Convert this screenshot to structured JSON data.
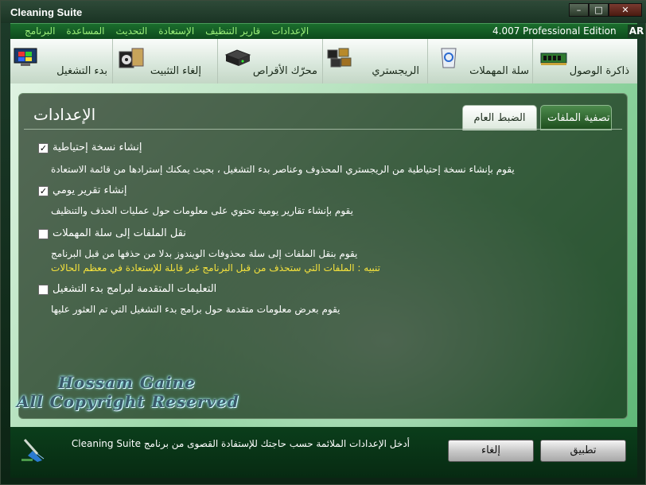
{
  "window": {
    "title": "Cleaning Suite"
  },
  "menubar": {
    "version": "4.007 Professional Edition",
    "lang": "AR",
    "items": [
      "البرنامج",
      "المساعدة",
      "التحديث",
      "الإستعادة",
      "قارير التنظيف",
      "الإعدادات"
    ]
  },
  "nav_tabs": [
    {
      "label": "ذاكرة الوصول",
      "icon": "memory-icon"
    },
    {
      "label": "سلة المهملات",
      "icon": "recycle-bin-icon"
    },
    {
      "label": "الريجستري",
      "icon": "registry-icon"
    },
    {
      "label": "محرّك الأقراص",
      "icon": "disk-drive-icon"
    },
    {
      "label": "إلغاء التثبيت",
      "icon": "uninstall-icon"
    },
    {
      "label": "بدء التشغيل",
      "icon": "startup-icon"
    }
  ],
  "settings": {
    "title": "الإعدادات",
    "subtabs": [
      {
        "label": "تصفية الملفات",
        "active": false
      },
      {
        "label": "الضبط العام",
        "active": true
      }
    ],
    "options": [
      {
        "label": "إنشاء نسخة إحتياطية",
        "checked": true,
        "desc": "يقوم بإنشاء نسخة إحتياطية من الريجستري المحذوف وعناصر بدء التشغيل ، بحيث يمكنك إسترادها من قائمة الاستعادة"
      },
      {
        "label": "إنشاء تقرير يومي",
        "checked": true,
        "desc": "يقوم بإنشاء تقارير يومية تحتوي على معلومات حول عمليات الحذف والتنظيف"
      },
      {
        "label": "نقل الملفات إلى سلة المهملات",
        "checked": false,
        "desc": "يقوم بنقل الملفات إلى سلة محذوفات الويندوز بدلا من حذفها من قبل البرنامج",
        "warn": "تنبيه : الملفات التي ستحذف من قبل البرنامج غير قابلة للإستعادة في معظم الحالات"
      },
      {
        "label": "التعليمات المتقدمة لبرامج بدء التشغيل",
        "checked": false,
        "desc": "يقوم بعرض معلومات متقدمة حول برامج  بدء التشغيل التي تم العثور عليها"
      }
    ]
  },
  "watermark": {
    "line1": "Hossam Gaine",
    "line2": "All Copyright Reserved"
  },
  "bottombar": {
    "hint": "أدخل الإعدادات الملائمة حسب حاجتك للإستفادة القصوى من برنامج Cleaning Suite",
    "apply_label": "تطبيق",
    "cancel_label": "إلغاء"
  }
}
